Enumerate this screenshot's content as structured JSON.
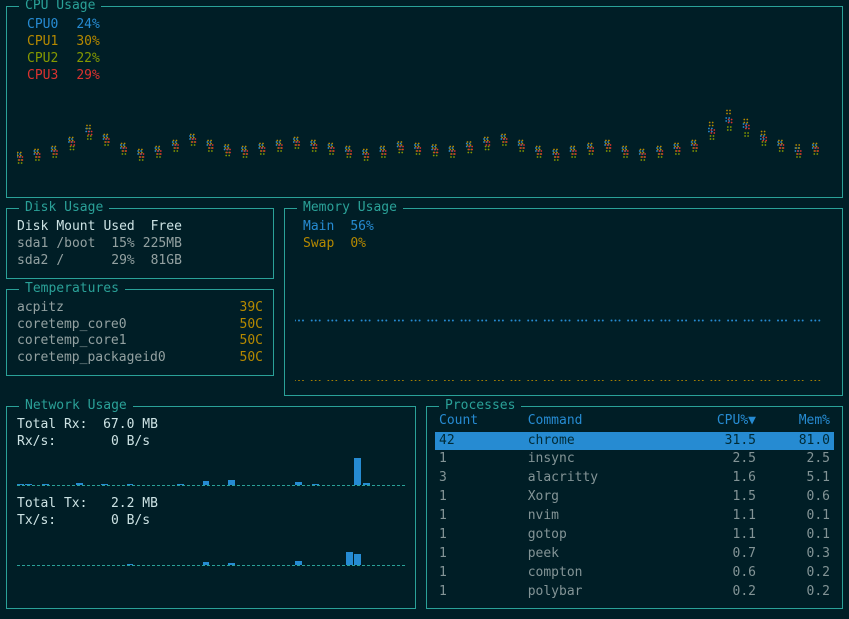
{
  "panels": {
    "cpu": "CPU Usage",
    "disk": "Disk Usage",
    "temp": "Temperatures",
    "mem": "Memory Usage",
    "net": "Network Usage",
    "proc": "Processes"
  },
  "cpu": {
    "items": [
      {
        "label": "CPU0",
        "value": "24%",
        "color": "c-blue"
      },
      {
        "label": "CPU1",
        "value": "30%",
        "color": "c-yellow"
      },
      {
        "label": "CPU2",
        "value": "22%",
        "color": "c-green"
      },
      {
        "label": "CPU3",
        "value": "29%",
        "color": "c-red"
      }
    ]
  },
  "disk": {
    "headers": [
      "Disk",
      "Mount",
      "Used",
      "Free"
    ],
    "rows": [
      {
        "disk": "sda1",
        "mount": "/boot",
        "used": "15%",
        "free": "225MB"
      },
      {
        "disk": "sda2",
        "mount": "/",
        "used": "29%",
        "free": "81GB"
      }
    ]
  },
  "temps": [
    {
      "name": "acpitz",
      "val": "39C"
    },
    {
      "name": "coretemp_core0",
      "val": "50C"
    },
    {
      "name": "coretemp_core1",
      "val": "50C"
    },
    {
      "name": "coretemp_packageid0",
      "val": "50C"
    }
  ],
  "mem": {
    "items": [
      {
        "label": "Main",
        "value": "56%",
        "color": "c-blue"
      },
      {
        "label": "Swap",
        "value": "0%",
        "color": "c-yellow"
      }
    ]
  },
  "net": {
    "rx_total_label": "Total Rx:",
    "rx_total_value": "67.0 MB",
    "rx_rate_label": "Rx/s:",
    "rx_rate_value": "0  B/s",
    "tx_total_label": "Total Tx:",
    "tx_total_value": "2.2 MB",
    "tx_rate_label": "Tx/s:",
    "tx_rate_value": "0  B/s"
  },
  "proc": {
    "headers": {
      "count": "Count",
      "command": "Command",
      "cpu": "CPU%▼",
      "mem": "Mem%"
    },
    "rows": [
      {
        "count": "42",
        "cmd": "chrome",
        "cpu": "31.5",
        "mem": "81.0",
        "sel": true
      },
      {
        "count": "1",
        "cmd": "insync",
        "cpu": "2.5",
        "mem": "2.5"
      },
      {
        "count": "3",
        "cmd": "alacritty",
        "cpu": "1.6",
        "mem": "5.1"
      },
      {
        "count": "1",
        "cmd": "Xorg",
        "cpu": "1.5",
        "mem": "0.6"
      },
      {
        "count": "1",
        "cmd": "nvim",
        "cpu": "1.1",
        "mem": "0.1"
      },
      {
        "count": "1",
        "cmd": "gotop",
        "cpu": "1.1",
        "mem": "0.1"
      },
      {
        "count": "1",
        "cmd": "peek",
        "cpu": "0.7",
        "mem": "0.3"
      },
      {
        "count": "1",
        "cmd": "compton",
        "cpu": "0.6",
        "mem": "0.2"
      },
      {
        "count": "1",
        "cmd": "polybar",
        "cpu": "0.2",
        "mem": "0.2"
      }
    ]
  },
  "chart_data": {
    "cpu_timeseries": {
      "type": "line",
      "series": [
        {
          "name": "CPU0",
          "color": "#268bd2",
          "values": [
            18,
            20,
            22,
            28,
            35,
            30,
            24,
            20,
            22,
            26,
            30,
            26,
            23,
            22,
            24,
            26,
            28,
            26,
            24,
            22,
            20,
            22,
            25,
            24,
            23,
            22,
            25,
            28,
            30,
            26,
            22,
            20,
            22,
            24,
            26,
            22,
            20,
            22,
            24,
            26,
            35,
            42,
            38,
            30,
            26,
            22,
            24
          ]
        },
        {
          "name": "CPU1",
          "color": "#b58900",
          "values": [
            20,
            22,
            24,
            30,
            38,
            32,
            26,
            22,
            24,
            28,
            32,
            28,
            25,
            24,
            26,
            28,
            30,
            28,
            26,
            24,
            22,
            24,
            27,
            26,
            25,
            24,
            27,
            30,
            32,
            28,
            24,
            22,
            24,
            26,
            28,
            24,
            22,
            24,
            26,
            28,
            40,
            48,
            42,
            34,
            28,
            25,
            26
          ]
        },
        {
          "name": "CPU2",
          "color": "#859900",
          "values": [
            16,
            18,
            20,
            25,
            32,
            28,
            22,
            18,
            20,
            24,
            28,
            24,
            21,
            20,
            22,
            24,
            26,
            24,
            22,
            20,
            18,
            20,
            23,
            22,
            21,
            20,
            23,
            25,
            28,
            24,
            20,
            18,
            20,
            22,
            24,
            20,
            18,
            20,
            22,
            24,
            32,
            38,
            34,
            28,
            24,
            20,
            22
          ]
        },
        {
          "name": "CPU3",
          "color": "#dc322f",
          "values": [
            19,
            21,
            23,
            29,
            36,
            31,
            25,
            21,
            23,
            27,
            31,
            27,
            24,
            23,
            25,
            27,
            29,
            27,
            25,
            23,
            21,
            23,
            26,
            25,
            24,
            23,
            26,
            29,
            31,
            27,
            23,
            21,
            23,
            25,
            27,
            23,
            21,
            23,
            25,
            27,
            37,
            44,
            40,
            32,
            27,
            23,
            25
          ]
        }
      ],
      "ylim": [
        0,
        60
      ]
    },
    "mem_timeseries": {
      "type": "line",
      "series": [
        {
          "name": "Main",
          "color": "#268bd2",
          "values": [
            56,
            56,
            56,
            56,
            56,
            56,
            56,
            56,
            56,
            56,
            56,
            56,
            56,
            56,
            56,
            56,
            56,
            56,
            56,
            56,
            56,
            56,
            56,
            56,
            56,
            56,
            56,
            56,
            56,
            56,
            56,
            56
          ]
        },
        {
          "name": "Swap",
          "color": "#b58900",
          "values": [
            0,
            0,
            0,
            0,
            0,
            0,
            0,
            0,
            0,
            0,
            0,
            0,
            0,
            0,
            0,
            0,
            0,
            0,
            0,
            0,
            0,
            0,
            0,
            0,
            0,
            0,
            0,
            0,
            0,
            0,
            0,
            0
          ]
        }
      ],
      "ylim": [
        0,
        100
      ]
    },
    "net_rx_bars": {
      "type": "bar",
      "color": "#268bd2",
      "values": [
        2,
        1,
        0,
        1,
        0,
        0,
        0,
        3,
        0,
        0,
        1,
        0,
        0,
        2,
        0,
        0,
        0,
        0,
        0,
        1,
        0,
        0,
        5,
        0,
        0,
        6,
        0,
        0,
        0,
        0,
        0,
        0,
        0,
        4,
        0,
        1,
        0,
        0,
        0,
        0,
        28,
        3,
        0,
        0,
        0,
        0
      ],
      "ylim": [
        0,
        32
      ]
    },
    "net_tx_bars": {
      "type": "bar",
      "color": "#268bd2",
      "values": [
        0,
        0,
        0,
        0,
        0,
        0,
        0,
        0,
        0,
        0,
        0,
        0,
        0,
        1,
        0,
        0,
        0,
        0,
        0,
        0,
        0,
        0,
        3,
        0,
        0,
        2,
        0,
        0,
        0,
        0,
        0,
        0,
        0,
        4,
        0,
        0,
        0,
        0,
        0,
        14,
        12,
        0,
        0,
        0,
        0,
        0
      ],
      "ylim": [
        0,
        32
      ]
    }
  }
}
